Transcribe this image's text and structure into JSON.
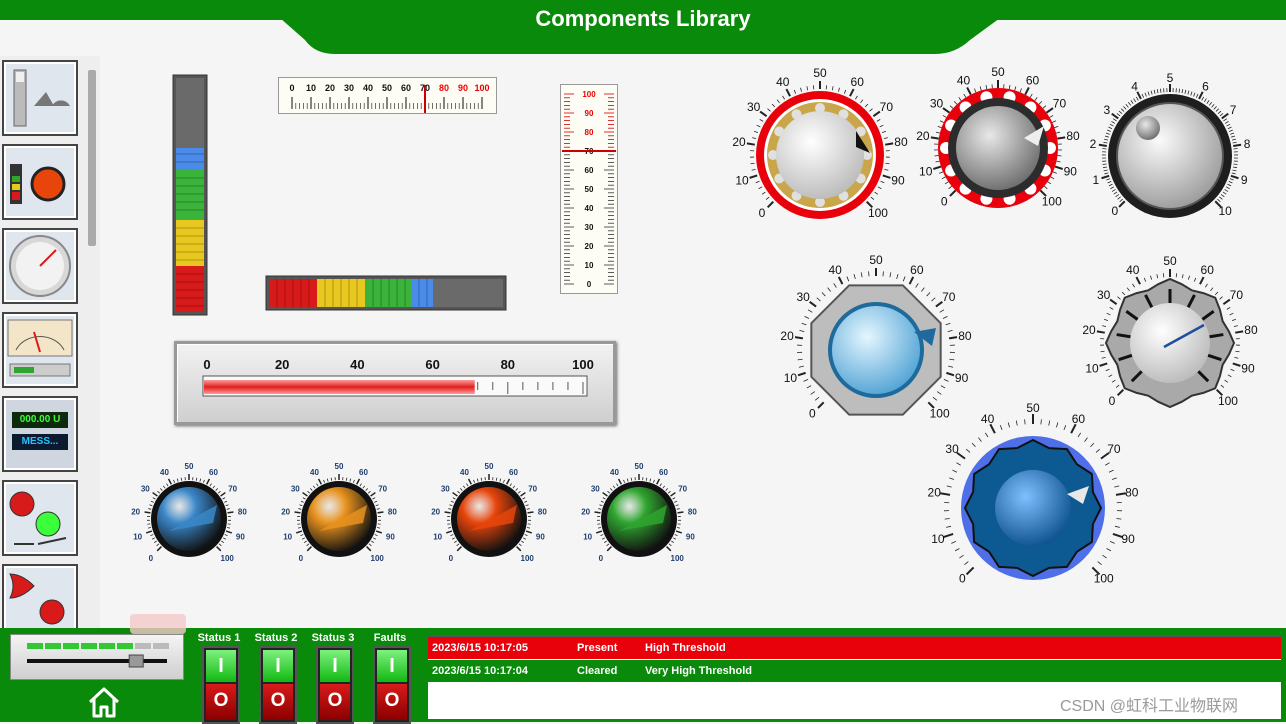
{
  "header": {
    "title": "Components Library"
  },
  "colors": {
    "brand_green": "#0a8a0a",
    "alarm_red": "#e8000b",
    "alarm_green": "#0a8a0a"
  },
  "sidebar": {
    "items": [
      {
        "name": "bar-graph-tile",
        "icon": "bar-graph-icon"
      },
      {
        "name": "level-knob-tile",
        "icon": "knob-icon"
      },
      {
        "name": "dial-gauge-tile",
        "icon": "dial-icon"
      },
      {
        "name": "analog-meter-tile",
        "icon": "meter-icon"
      },
      {
        "name": "display-tile",
        "icon": "numeric-display-icon",
        "value_text": "000.00 U",
        "message_text": "MESS..."
      },
      {
        "name": "pump-motor-tile",
        "icon": "pump-icon"
      },
      {
        "name": "logic-gate-tile",
        "icon": "logic-gate-icon"
      }
    ]
  },
  "vertical_bar": {
    "segments": [
      "blue",
      "green",
      "yellow",
      "red"
    ]
  },
  "horizontal_bar": {
    "segments": [
      "red",
      "yellow",
      "green",
      "blue"
    ]
  },
  "linear_scale": {
    "ticks": [
      "0",
      "10",
      "20",
      "30",
      "40",
      "50",
      "60",
      "70",
      "80",
      "90",
      "100"
    ],
    "pointer_value": 70,
    "red_from": 70
  },
  "thermometer": {
    "ticks": [
      "100",
      "90",
      "80",
      "70",
      "60",
      "50",
      "40",
      "30",
      "20",
      "10",
      "0"
    ],
    "value": 70
  },
  "progress_bar": {
    "ticks": [
      "0",
      "20",
      "40",
      "60",
      "80",
      "100"
    ],
    "value": 72
  },
  "small_knobs": {
    "ticks": [
      "0",
      "10",
      "20",
      "30",
      "40",
      "50",
      "60",
      "70",
      "80",
      "90",
      "100"
    ],
    "items": [
      {
        "name": "blue",
        "color": "#3a87c8"
      },
      {
        "name": "orange",
        "color": "#e8921e"
      },
      {
        "name": "red-orange",
        "color": "#e8450b"
      },
      {
        "name": "green",
        "color": "#2fa52f"
      }
    ]
  },
  "large_knobs": {
    "ticks_100": [
      "0",
      "10",
      "20",
      "30",
      "40",
      "50",
      "60",
      "70",
      "80",
      "90",
      "100"
    ],
    "ticks_10": [
      "0",
      "1",
      "2",
      "3",
      "4",
      "5",
      "6",
      "7",
      "8",
      "9",
      "10"
    ]
  },
  "footer": {
    "slider_value": 0.78,
    "home_icon": "home-icon",
    "status": [
      {
        "label": "Status 1",
        "on": "I",
        "off": "O"
      },
      {
        "label": "Status 2",
        "on": "I",
        "off": "O"
      },
      {
        "label": "Status 3",
        "on": "I",
        "off": "O"
      },
      {
        "label": "Faults",
        "on": "I",
        "off": "O"
      }
    ],
    "alarms": [
      {
        "time": "2023/6/15 10:17:05",
        "state": "Present",
        "message": "High Threshold",
        "color": "#e8000b"
      },
      {
        "time": "2023/6/15 10:17:04",
        "state": "Cleared",
        "message": "Very High Threshold",
        "color": "#0a8a0a"
      }
    ]
  },
  "watermark": "CSDN @虹科工业物联网"
}
